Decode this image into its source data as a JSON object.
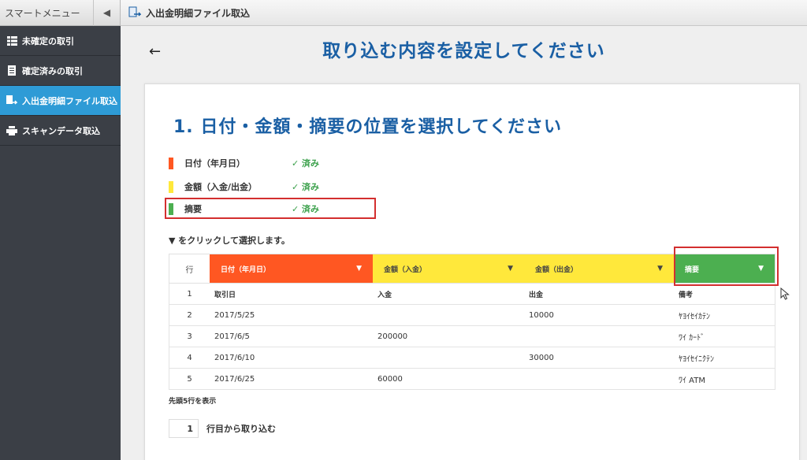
{
  "sidebar": {
    "header_title": "スマートメニュー",
    "collapse_icon": "chevron-left-icon",
    "items": [
      {
        "label": "未確定の取引",
        "icon": "list-icon",
        "active": false
      },
      {
        "label": "確定済みの取引",
        "icon": "document-icon",
        "active": false
      },
      {
        "label": "入出金明細ファイル取込",
        "icon": "file-import-icon",
        "active": true
      },
      {
        "label": "スキャンデータ取込",
        "icon": "scanner-icon",
        "active": false
      }
    ]
  },
  "topbar": {
    "title": "入出金明細ファイル取込"
  },
  "main": {
    "title": "取り込む内容を設定してください",
    "back_icon": "arrow-left-icon",
    "step_title": "1. 日付・金額・摘要の位置を選択してください",
    "legend": [
      {
        "label": "日付（年月日）",
        "status": "✓ 済み",
        "color": "#ff5722"
      },
      {
        "label": "金額（入金/出金）",
        "status": "✓ 済み",
        "color": "#ffe83b"
      },
      {
        "label": "摘要",
        "status": "✓ 済み",
        "color": "#4caf50"
      }
    ],
    "hint": "▼ をクリックして選択します。",
    "table": {
      "row_header": "行",
      "columns": [
        {
          "label": "日付（年月日）"
        },
        {
          "label": "金額（入金）"
        },
        {
          "label": "金額（出金）"
        },
        {
          "label": "摘要"
        }
      ],
      "rows": [
        {
          "n": "1",
          "d": "取引日",
          "i": "入金",
          "o": "出金",
          "s": "備考"
        },
        {
          "n": "2",
          "d": "2017/5/25",
          "i": "",
          "o": "10000",
          "s": "ﾔﾖｲｾｲｶﾃﾝ"
        },
        {
          "n": "3",
          "d": "2017/6/5",
          "i": "200000",
          "o": "",
          "s": "ﾜｲ ｶｰﾄﾞ"
        },
        {
          "n": "4",
          "d": "2017/6/10",
          "i": "",
          "o": "30000",
          "s": "ﾔﾖｲｾｲﾆｸﾃﾝ"
        },
        {
          "n": "5",
          "d": "2017/6/25",
          "i": "60000",
          "o": "",
          "s": "ﾜｲ ATM"
        }
      ]
    },
    "shown_text": "先頭5行を表示",
    "start_row_value": "1",
    "start_row_label": "行目から取り込む"
  }
}
